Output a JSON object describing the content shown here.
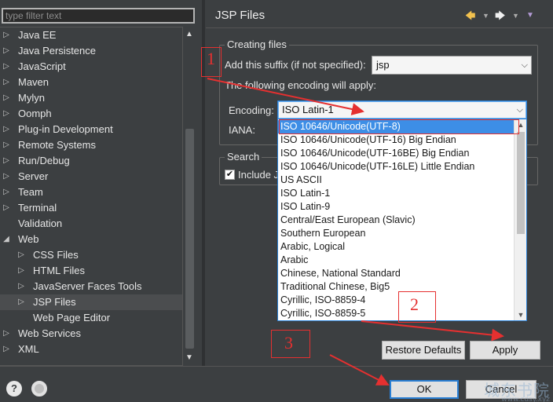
{
  "filter": {
    "placeholder": "type filter text"
  },
  "tree": {
    "items": [
      {
        "label": "Java EE",
        "expandable": true
      },
      {
        "label": "Java Persistence",
        "expandable": true
      },
      {
        "label": "JavaScript",
        "expandable": true
      },
      {
        "label": "Maven",
        "expandable": true
      },
      {
        "label": "Mylyn",
        "expandable": true
      },
      {
        "label": "Oomph",
        "expandable": true
      },
      {
        "label": "Plug-in Development",
        "expandable": true
      },
      {
        "label": "Remote Systems",
        "expandable": true
      },
      {
        "label": "Run/Debug",
        "expandable": true
      },
      {
        "label": "Server",
        "expandable": true
      },
      {
        "label": "Team",
        "expandable": true
      },
      {
        "label": "Terminal",
        "expandable": true
      },
      {
        "label": "Validation",
        "expandable": false
      },
      {
        "label": "Web",
        "expandable": true,
        "expanded": true
      },
      {
        "label": "CSS Files",
        "expandable": true,
        "indent": 1
      },
      {
        "label": "HTML Files",
        "expandable": true,
        "indent": 1
      },
      {
        "label": "JavaServer Faces Tools",
        "expandable": true,
        "indent": 1
      },
      {
        "label": "JSP Files",
        "expandable": true,
        "indent": 1,
        "selected": true
      },
      {
        "label": "Web Page Editor",
        "expandable": false,
        "indent": 1
      },
      {
        "label": "Web Services",
        "expandable": true
      },
      {
        "label": "XML",
        "expandable": true
      }
    ]
  },
  "panel": {
    "title": "JSP Files",
    "creating_files": {
      "group_title": "Creating files",
      "suffix_label": "Add this suffix (if not specified):",
      "suffix_value": "jsp",
      "encoding_note": "The following encoding will apply:",
      "encoding_label": "Encoding:",
      "encoding_value": "ISO Latin-1",
      "iana_label": "IANA:"
    },
    "search": {
      "group_title": "Search",
      "include_label": "Include J"
    },
    "encoding_options": [
      "ISO 10646/Unicode(UTF-8)",
      "ISO 10646/Unicode(UTF-16) Big Endian",
      "ISO 10646/Unicode(UTF-16BE) Big Endian",
      "ISO 10646/Unicode(UTF-16LE) Little Endian",
      "US ASCII",
      "ISO Latin-1",
      "ISO Latin-9",
      "Central/East European (Slavic)",
      "Southern European",
      "Arabic, Logical",
      "Arabic",
      "Chinese, National Standard",
      "Traditional Chinese, Big5",
      "Cyrillic, ISO-8859-4",
      "Cyrillic, ISO-8859-5"
    ],
    "restore_defaults": "Restore Defaults",
    "apply": "Apply"
  },
  "footer": {
    "ok": "OK",
    "cancel": "Cancel",
    "help_glyph": "?"
  },
  "annotations": {
    "n1": "1",
    "n2": "2",
    "n3": "3",
    "color": "#e53030"
  },
  "watermark": {
    "text": "城东书院",
    "url": "www.cdsy.xyz"
  },
  "icons": {
    "back": "back-arrow-icon",
    "forward": "forward-arrow-icon",
    "menu": "view-menu-icon"
  }
}
